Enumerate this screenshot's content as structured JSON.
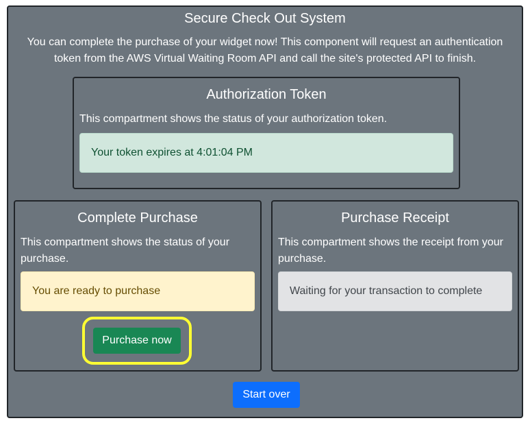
{
  "page": {
    "title": "Secure Check Out System",
    "intro": "You can complete the purchase of your widget now! This component will request an authentication token from the AWS Virtual Waiting Room API and call the site's protected API to finish."
  },
  "auth_card": {
    "title": "Authorization Token",
    "description": "This compartment shows the status of your authorization token.",
    "status": "Your token expires at 4:01:04 PM"
  },
  "purchase_card": {
    "title": "Complete Purchase",
    "description": "This compartment shows the status of your purchase.",
    "status": "You are ready to purchase",
    "button_label": "Purchase now"
  },
  "receipt_card": {
    "title": "Purchase Receipt",
    "description": "This compartment shows the receipt from your purchase.",
    "status": "Waiting for your transaction to complete"
  },
  "footer": {
    "start_over_label": "Start over"
  },
  "colors": {
    "panel_background": "#6c757d",
    "success_alert": "#d1e7dd",
    "warning_alert": "#fff3cd",
    "secondary_alert": "#e2e3e5",
    "success_button": "#198754",
    "primary_button": "#0d6efd",
    "highlight": "#ffff33"
  }
}
